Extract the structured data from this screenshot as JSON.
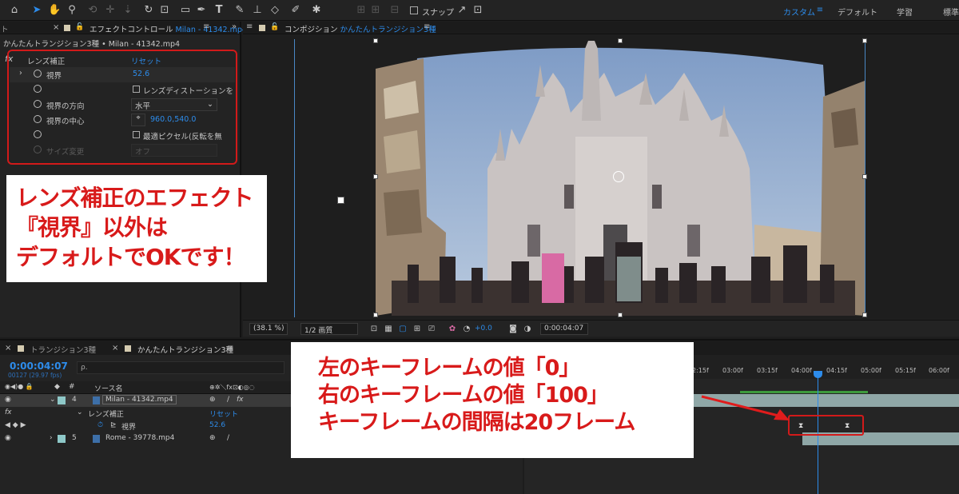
{
  "toolbar": {
    "snap_label": "スナップ",
    "workspaces": [
      "カスタム",
      "デフォルト",
      "学習",
      "標準"
    ]
  },
  "effect_panel": {
    "tab_prefix": "ト",
    "tab_label": "エフェクトコントロール",
    "tab_file": "Milan - 41342.mp4",
    "layer_path": "かんたんトランジション3種 • Milan - 41342.mp4",
    "effect_name": "レンズ補正",
    "reset_label": "リセット",
    "rows": {
      "fov_label": "視界",
      "fov_value": "52.6",
      "distortion_checkbox": "レンズディストーションを",
      "direction_label": "視界の方向",
      "direction_value": "水平",
      "center_label": "視界の中心",
      "center_value": "960.0,540.0",
      "optimal_checkbox": "最適ピクセル(反転を無",
      "resize_label": "サイズ変更",
      "resize_value": "オフ"
    }
  },
  "annotation_left": {
    "line1": "レンズ補正のエフェクト",
    "line2": "『視界』以外は",
    "line3": "デフォルトでOKです！"
  },
  "annotation_right": {
    "line1": "左のキーフレームの値「0」",
    "line2": "右のキーフレームの値「100」",
    "line3": "キーフレームの間隔は20フレーム"
  },
  "comp_panel": {
    "tab_label": "コンポジション",
    "tab_comp_name": "かんたんトランジション3種",
    "zoom": "(38.1 %)",
    "resolution": "1/2 画質",
    "exposure": "+0.0",
    "timecode": "0:00:04:07"
  },
  "timeline": {
    "tabs": [
      "トランジション3種",
      "かんたんトランジション3種"
    ],
    "timecode": "0:00:04:07",
    "fps": "00127 (29.97 fps)",
    "search_placeholder": "ρ.",
    "source_header": "ソース名",
    "ruler": [
      "2:15f",
      "03:00f",
      "03:15f",
      "04:00f",
      "04:15f",
      "05:00f",
      "05:15f",
      "06:00f"
    ],
    "layers": [
      {
        "num": "4",
        "name": "Milan - 41342.mp4"
      },
      {
        "num": "5",
        "name": "Rome - 39778.mp4"
      }
    ],
    "effect_row": "レンズ補正",
    "effect_reset": "リセット",
    "fov_label": "視界",
    "fov_value": "52.6"
  }
}
